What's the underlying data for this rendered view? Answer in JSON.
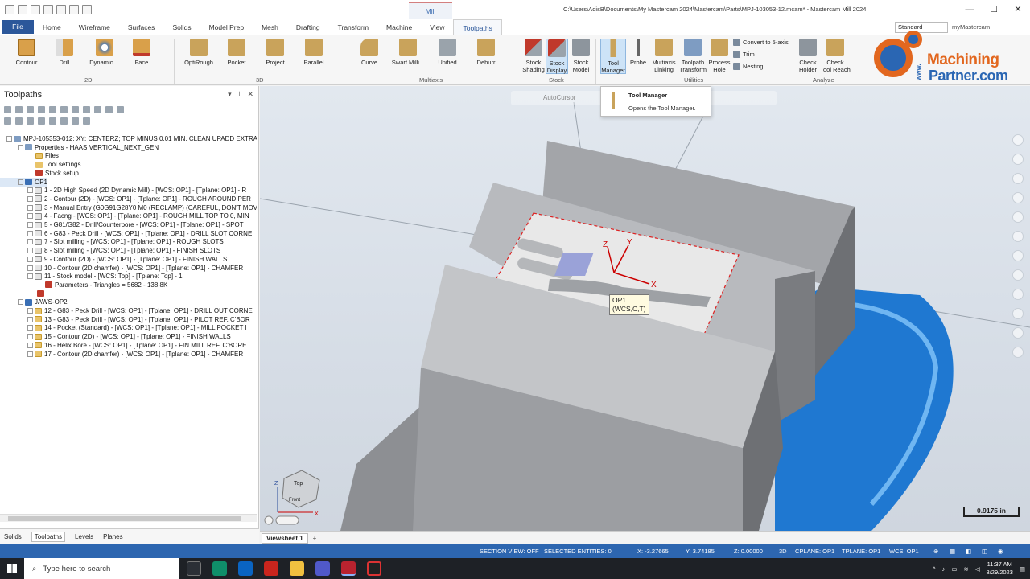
{
  "window": {
    "title": "C:\\Users\\AdisB\\Documents\\My Mastercam 2024\\Mastercam\\Parts\\MPJ-103053-12.mcam* - Mastercam Mill 2024",
    "context_tab": "Mill",
    "controls": [
      "—",
      "☐",
      "✕"
    ]
  },
  "ribbon_tabs": {
    "file": "File",
    "items": [
      "Home",
      "Wireframe",
      "Surfaces",
      "Solids",
      "Model Prep",
      "Mesh",
      "Drafting",
      "Transform",
      "Machine",
      "View"
    ],
    "active": "Toolpaths",
    "standard": "Standard",
    "mymastercam": "myMastercam"
  },
  "ribbon": {
    "groups": {
      "g2d": "2D",
      "g3d": "3D",
      "multiaxis": "Multiaxis",
      "stock": "Stock",
      "utilities": "Utilities",
      "analyze": "Analyze"
    },
    "b2d": {
      "contour": "Contour",
      "drill": "Drill",
      "dynamic": "Dynamic ...",
      "face": "Face"
    },
    "b3d": {
      "optirough": "OptiRough",
      "pocket": "Pocket",
      "project": "Project",
      "parallel": "Parallel"
    },
    "bmulti": {
      "curve": "Curve",
      "swarf": "Swarf Milli...",
      "unified": "Unified",
      "deburr": "Deburr"
    },
    "bstock": {
      "shading1": "Stock",
      "shading2": "Shading",
      "display1": "Stock",
      "display2": "Display",
      "model1": "Stock",
      "model2": "Model"
    },
    "butil": {
      "tool1": "Tool",
      "tool2": "Manager",
      "probe": "Probe",
      "multi1": "Multiaxis",
      "multi2": "Linking",
      "tt1": "Toolpath",
      "tt2": "Transform",
      "ph1": "Process",
      "ph2": "Hole",
      "convert": "Convert to 5-axis",
      "trim": "Trim",
      "nesting": "Nesting"
    },
    "banalyze": {
      "holder1": "Check",
      "holder2": "Holder",
      "reach1": "Check",
      "reach2": "Tool Reach"
    }
  },
  "logo": {
    "line1": "Machining",
    "line2": "Partner.com",
    "www": "www."
  },
  "tooltip": {
    "title": "Tool Manager",
    "description": "Opens the Tool Manager."
  },
  "panel": {
    "title": "Toolpaths",
    "tree": {
      "root": "MPJ-105353-012: XY: CENTERZ; TOP MINUS 0.01 MIN. CLEAN UPADD EXTRA",
      "properties": "Properties - HAAS VERTICAL_NEXT_GEN",
      "files": "Files",
      "tool_settings": "Tool settings",
      "stock_setup": "Stock setup",
      "op1": "OP1",
      "op1_items": [
        "1 - 2D High Speed (2D Dynamic Mill) - [WCS: OP1] - [Tplane: OP1] - R",
        "2 - Contour (2D) - [WCS: OP1] - [Tplane: OP1] - ROUGH AROUND PER",
        "3 - Manual Entry (G0G91G28Y0 M0 (RECLAMP) (CAREFUL, DON'T MOV",
        "4 - Facng - [WCS: OP1] - [Tplane: OP1] - ROUGH MILL TOP TO 0, MIN",
        "5 - G81/G82 - Drill/Counterbore - [WCS: OP1] - [Tplane: OP1] - SPOT",
        "6 - G83 - Peck Drill - [WCS: OP1] - [Tplane: OP1] - DRILL SLOT CORNE",
        "7 - Slot milling - [WCS: OP1] - [Tplane: OP1] - ROUGH SLOTS",
        "8 - Slot milling - [WCS: OP1] - [Tplane: OP1] - FINISH SLOTS",
        "9 - Contour (2D) - [WCS: OP1] - [Tplane: OP1] - FINISH WALLS",
        "10 - Contour (2D chamfer) - [WCS: OP1] - [Tplane: OP1] - CHAMFER",
        "11 - Stock model - [WCS: Top] - [Tplane: Top] - 1"
      ],
      "params": "Parameters - Triangles = 5682 - 138.8K",
      "op2": "JAWS-OP2",
      "op2_items": [
        "12 - G83 - Peck Drill - [WCS: OP1] - [Tplane: OP1] - DRILL OUT CORNE",
        "13 - G83 - Peck Drill - [WCS: OP1] - [Tplane: OP1] - PILOT REF. C'BOR",
        "14 - Pocket (Standard) - [WCS: OP1] - [Tplane: OP1] - MILL POCKET I",
        "15 - Contour (2D) - [WCS: OP1] - [Tplane: OP1] - FINISH WALLS",
        "16 - Helix Bore - [WCS: OP1] - [Tplane: OP1] - FIN MILL REF. C'BORE",
        "17 - Contour (2D chamfer) - [WCS: OP1] - [Tplane: OP1] - CHAMFER"
      ]
    },
    "bottom_tabs": [
      "Solids",
      "Toolpaths",
      "Levels",
      "Planes"
    ]
  },
  "viewport": {
    "autocursor": "AutoCursor",
    "wcs_label_1": "OP1",
    "wcs_label_2": "(WCS,C,T)",
    "axis_x": "X",
    "axis_y": "Y",
    "axis_z": "Z",
    "cube_top": "Top",
    "cube_front": "Front",
    "scale": "0.9175 in",
    "viewsheet": "Viewsheet 1",
    "viewsheet_add": "+"
  },
  "statusbar": {
    "section_view": "SECTION VIEW: OFF",
    "selected": "SELECTED ENTITIES: 0",
    "x": "X:  -3.27665",
    "y": "Y:  3.74185",
    "z": "Z:  0.00000",
    "mode": "3D",
    "cplane": "CPLANE: OP1",
    "tplane": "TPLANE: OP1",
    "wcs": "WCS: OP1"
  },
  "taskbar": {
    "search_placeholder": "Type here to search",
    "time": "11:37 AM",
    "date": "8/29/2023"
  },
  "colors": {
    "accent": "#2b579a",
    "statusbar": "#2d66b0",
    "vise_blue": "#1f78d1",
    "logo_orange": "#e2671f"
  }
}
